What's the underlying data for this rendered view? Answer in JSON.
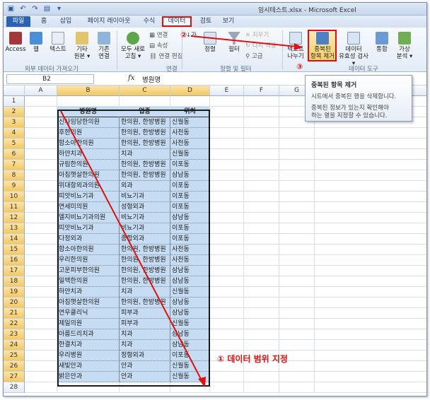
{
  "window": {
    "title": "임시테스트.xlsx - Microsoft Excel"
  },
  "qat": [
    "save-icon",
    "undo-icon",
    "redo-icon",
    "print-preview-icon",
    "customize-icon"
  ],
  "tabs": [
    "파일",
    "홈",
    "삽입",
    "페이지 레이아웃",
    "수식",
    "데이터",
    "검토",
    "보기"
  ],
  "ribbon": {
    "external": {
      "access": "Access",
      "web": "웹",
      "text": "텍스트",
      "other_l1": "기타",
      "other_l2": "원본 ▾",
      "existing_l1": "기존",
      "existing_l2": "연결",
      "group": "외부 데이터 가져오기"
    },
    "connections": {
      "refresh_l1": "모두 새로",
      "refresh_l2": "고침 ▾",
      "conn": "연결",
      "props": "속성",
      "edit": "연결 편집",
      "group": "연결"
    },
    "sort": {
      "az": "↓가",
      "sort": "정렬",
      "filter": "필터",
      "clear": "지우기",
      "reapply": "다시 적용",
      "advanced": "고급",
      "group": "정렬 및 필터"
    },
    "tools": {
      "t2c_l1": "텍스트",
      "t2c_l2": "나누기",
      "dup_l1": "중복된",
      "dup_l2": "항목 제거",
      "valid_l1": "데이터",
      "valid_l2": "유효성 검사 ▾",
      "consol": "통합",
      "whatif_l1": "가상",
      "whatif_l2": "분석 ▾",
      "group": "데이터 도구"
    }
  },
  "markers": {
    "m1": "①",
    "m2": "②",
    "m3": "③",
    "annotation": "① 데이터 범위 지정"
  },
  "formula_bar": {
    "name_box": "B2",
    "fx": "fx",
    "value": "병원명"
  },
  "tooltip": {
    "title": "중복된 항목 제거",
    "line1": "시트에서 중복된 행을 삭제합니다.",
    "line2a": "중복된 정보가 있는지 확인해야",
    "line2b": "하는 열을 지정할 수 있습니다."
  },
  "sheet": {
    "columns": [
      "A",
      "B",
      "C",
      "D",
      "E",
      "F",
      "G"
    ],
    "header": [
      "병원명",
      "업종",
      "위치"
    ],
    "rows": [
      [
        "신사임당한의원",
        "한의원, 한방병원",
        "신월동"
      ],
      [
        "후한의원",
        "한의원, 한방병원",
        "사천동"
      ],
      [
        "함소아한의원",
        "한의원, 한방병원",
        "사천동"
      ],
      [
        "하얀치과",
        "치과",
        "신월동"
      ],
      [
        "규림한의원",
        "한의원, 한방병원",
        "이포동"
      ],
      [
        "아침햇살한의원",
        "한의원, 한방병원",
        "삼남동"
      ],
      [
        "위대항외과의원",
        "외과",
        "이포동"
      ],
      [
        "띠앗비뇨기과",
        "비뇨기과",
        "이포동"
      ],
      [
        "연세미의원",
        "성형외과",
        "이포동"
      ],
      [
        "엘지비뇨기과의원",
        "비뇨기과",
        "삼남동"
      ],
      [
        "띠앗비뇨기과",
        "비뇨기과",
        "이포동"
      ],
      [
        "다정외과",
        "종합외과",
        "이포동"
      ],
      [
        "함소아한의원",
        "한의원, 한방병원",
        "사천동"
      ],
      [
        "우리한의원",
        "한의원, 한방병원",
        "사천동"
      ],
      [
        "고운피부한의원",
        "한의원, 한방병원",
        "삼남동"
      ],
      [
        "일맥한의원",
        "한의원, 한방병원",
        "삼남동"
      ],
      [
        "하얀치과",
        "치과",
        "신월동"
      ],
      [
        "아침햇살한의원",
        "한의원, 한방병원",
        "삼남동"
      ],
      [
        "연우클리닉",
        "피부과",
        "삼남동"
      ],
      [
        "제일의원",
        "피부과",
        "신월동"
      ],
      [
        "아름드리치과",
        "치과",
        "삼남동"
      ],
      [
        "한결치과",
        "치과",
        "삼남동"
      ],
      [
        "우리병원",
        "정형외과",
        "이포동"
      ],
      [
        "새빛안과",
        "안과",
        "신월동"
      ],
      [
        "밝은안과",
        "안과",
        "신월동"
      ]
    ]
  },
  "colors": {
    "accent_red": "#e01010",
    "selection_fill": "#c6dcf3",
    "file_tab": "#2a62b8"
  }
}
